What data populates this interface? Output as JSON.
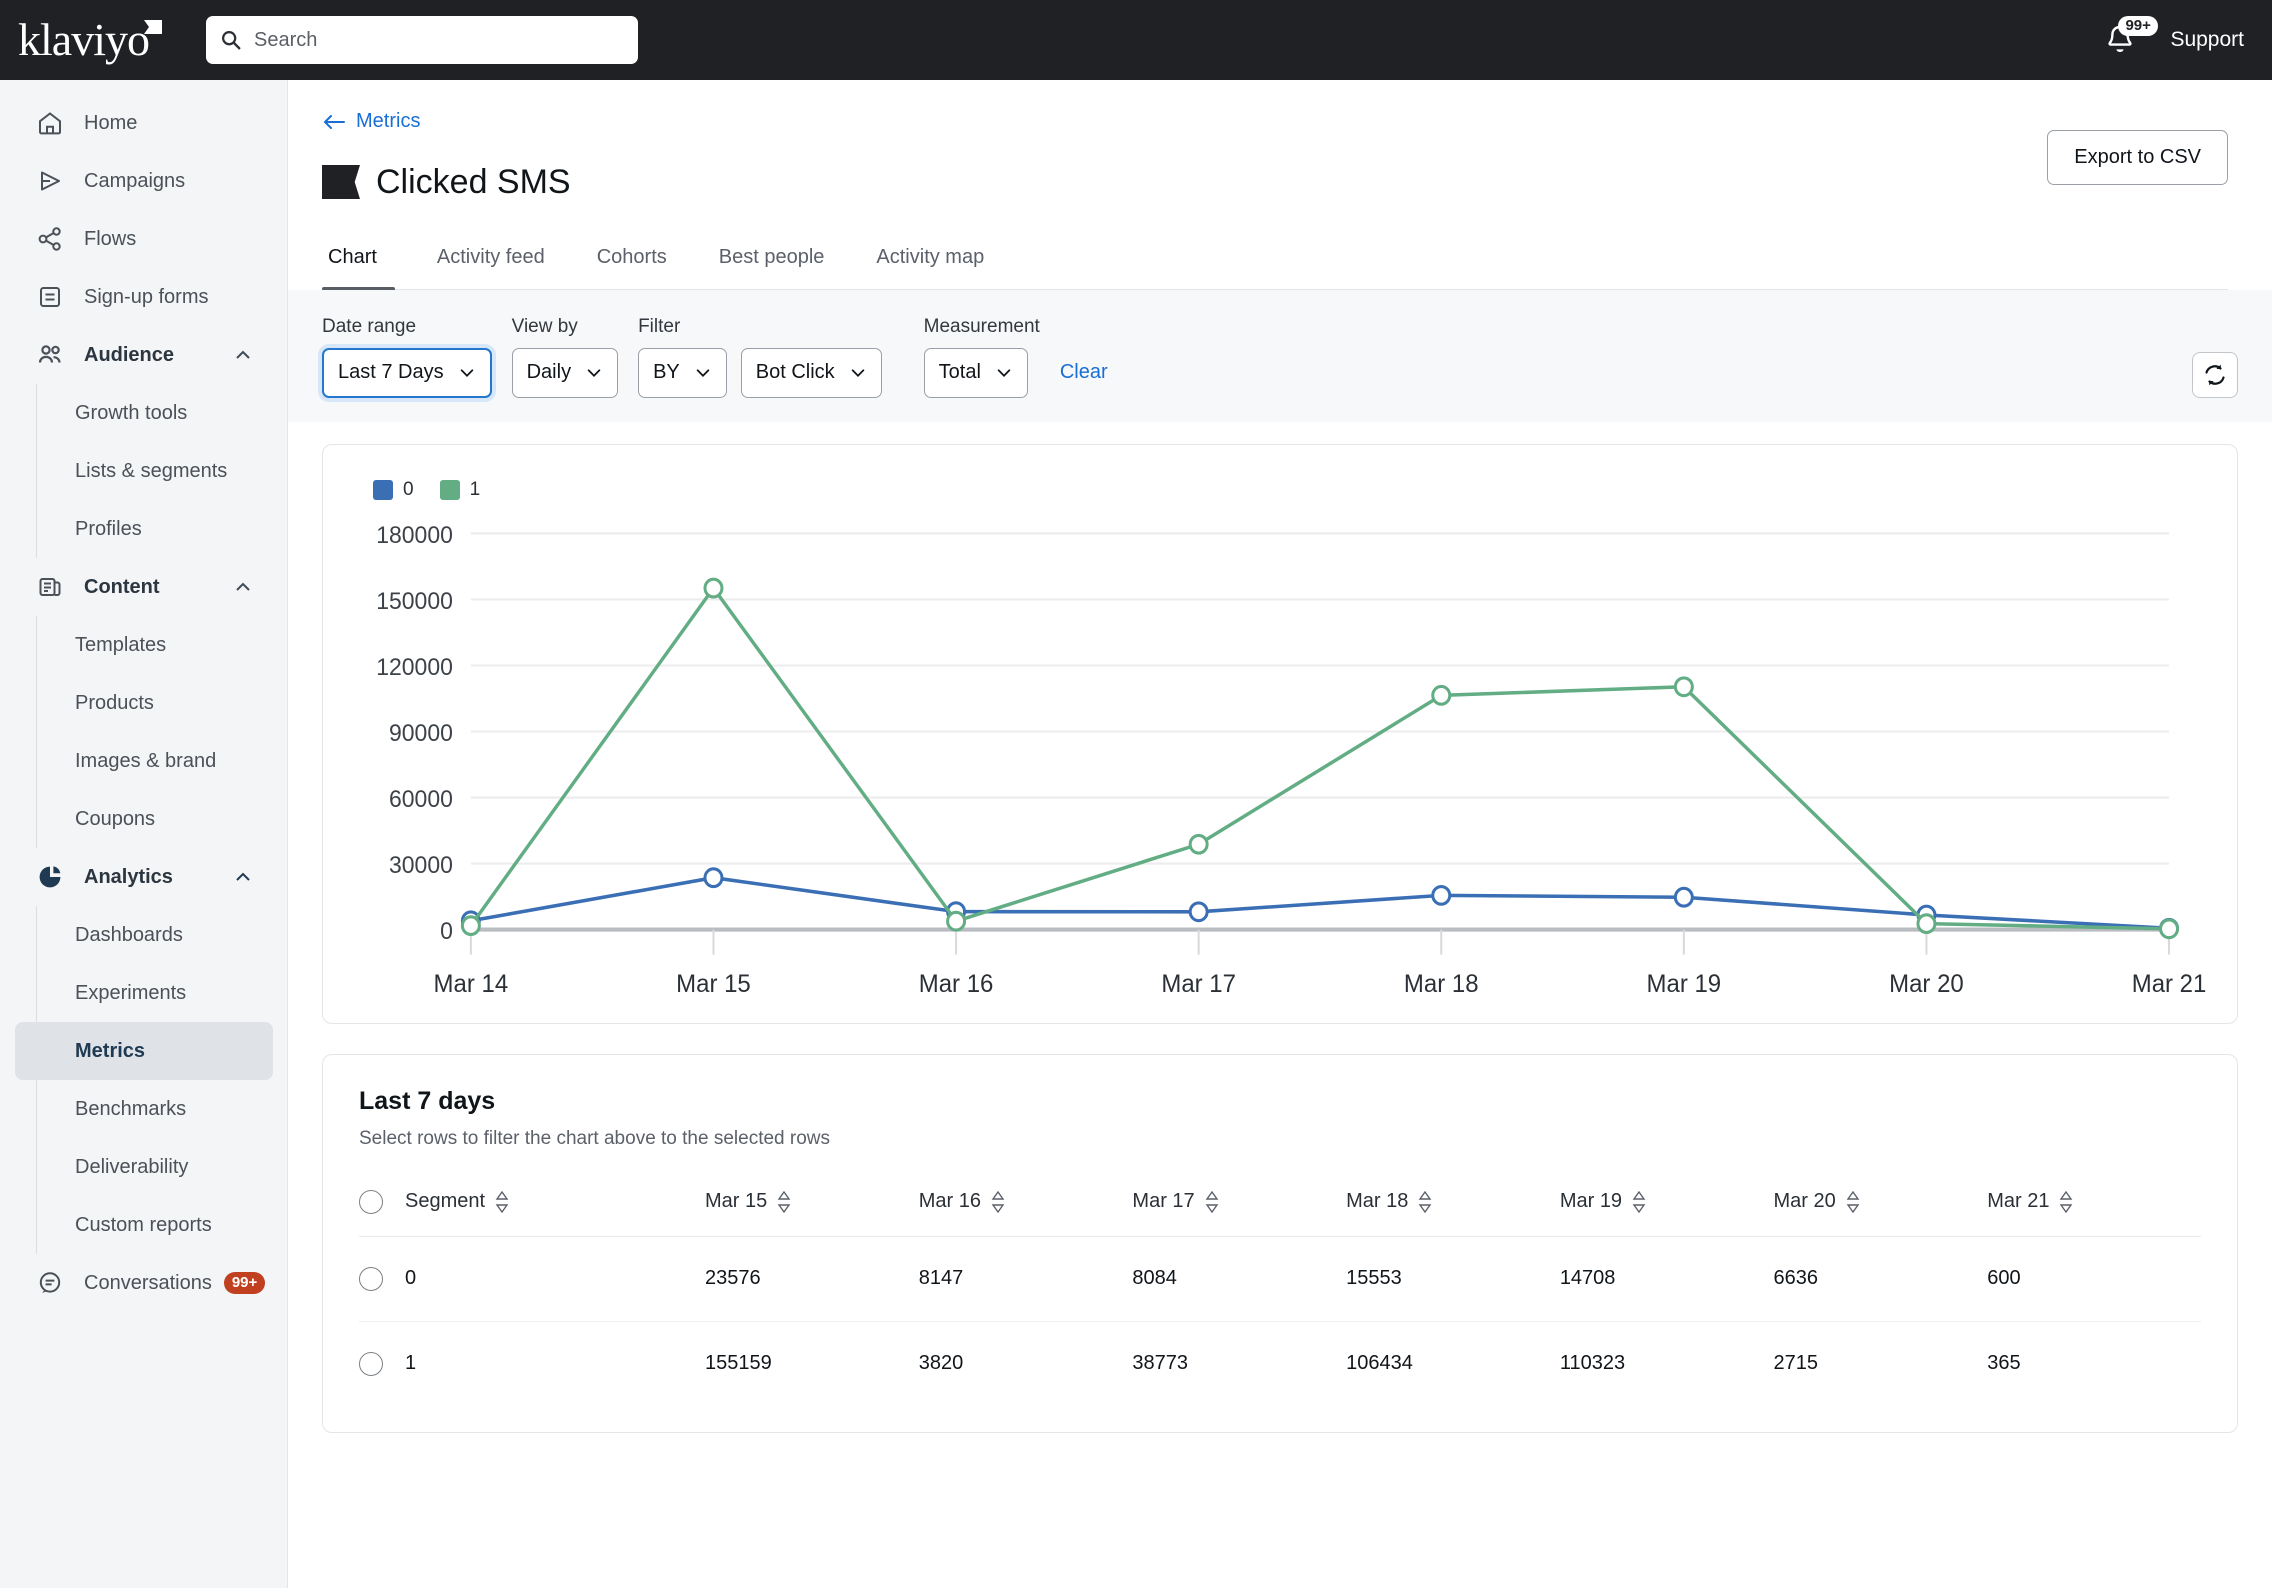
{
  "topbar": {
    "brand": "klaviyo",
    "search_placeholder": "Search",
    "notifications_badge": "99+",
    "support_label": "Support"
  },
  "sidebar": {
    "items": [
      {
        "label": "Home",
        "icon": "home-icon",
        "type": "item"
      },
      {
        "label": "Campaigns",
        "icon": "campaigns-icon",
        "type": "item"
      },
      {
        "label": "Flows",
        "icon": "flows-icon",
        "type": "item"
      },
      {
        "label": "Sign-up forms",
        "icon": "signup-forms-icon",
        "type": "item"
      },
      {
        "label": "Audience",
        "icon": "audience-icon",
        "type": "group",
        "expanded": true
      },
      {
        "label": "Growth tools",
        "type": "sub"
      },
      {
        "label": "Lists & segments",
        "type": "sub"
      },
      {
        "label": "Profiles",
        "type": "sub"
      },
      {
        "label": "Content",
        "icon": "content-icon",
        "type": "group",
        "expanded": true
      },
      {
        "label": "Templates",
        "type": "sub"
      },
      {
        "label": "Products",
        "type": "sub"
      },
      {
        "label": "Images & brand",
        "type": "sub"
      },
      {
        "label": "Coupons",
        "type": "sub"
      },
      {
        "label": "Analytics",
        "icon": "analytics-icon",
        "type": "group",
        "expanded": true
      },
      {
        "label": "Dashboards",
        "type": "sub"
      },
      {
        "label": "Experiments",
        "type": "sub"
      },
      {
        "label": "Metrics",
        "type": "sub",
        "active": true
      },
      {
        "label": "Benchmarks",
        "type": "sub"
      },
      {
        "label": "Deliverability",
        "type": "sub"
      },
      {
        "label": "Custom reports",
        "type": "sub"
      },
      {
        "label": "Conversations",
        "icon": "conversations-icon",
        "type": "item",
        "badge": "99+"
      }
    ]
  },
  "page": {
    "breadcrumb": "Metrics",
    "title": "Clicked SMS",
    "export_label": "Export to CSV",
    "tabs": [
      {
        "label": "Chart",
        "active": true
      },
      {
        "label": "Activity feed",
        "active": false
      },
      {
        "label": "Cohorts",
        "active": false
      },
      {
        "label": "Best people",
        "active": false
      },
      {
        "label": "Activity map",
        "active": false
      }
    ]
  },
  "filters": {
    "date_range": {
      "label": "Date range",
      "value": "Last 7 Days"
    },
    "view_by": {
      "label": "View by",
      "value": "Daily"
    },
    "filter": {
      "label": "Filter",
      "operator": "BY",
      "value": "Bot Click"
    },
    "measurement": {
      "label": "Measurement",
      "value": "Total"
    },
    "clear_label": "Clear"
  },
  "chart_data": {
    "type": "line",
    "title": "",
    "xlabel": "",
    "ylabel": "",
    "grid": true,
    "legend_position": "top-left",
    "x": [
      "Mar 14",
      "Mar 15",
      "Mar 16",
      "Mar 17",
      "Mar 18",
      "Mar 19",
      "Mar 20",
      "Mar 21"
    ],
    "ylim": [
      0,
      180000
    ],
    "yticks": [
      0,
      30000,
      60000,
      90000,
      120000,
      150000,
      180000
    ],
    "ytick_labels": [
      "0",
      "30000",
      "60000",
      "90000",
      "120000",
      "150000",
      "180000"
    ],
    "series": [
      {
        "name": "0",
        "color": "#3b6fb5",
        "values": [
          4000,
          23576,
          8147,
          8084,
          15553,
          14708,
          6636,
          600
        ]
      },
      {
        "name": "1",
        "color": "#62ad83",
        "values": [
          1800,
          155159,
          3820,
          38773,
          106434,
          110323,
          2715,
          365
        ]
      }
    ]
  },
  "table": {
    "title": "Last 7 days",
    "subtitle": "Select rows to filter the chart above to the selected rows",
    "columns": [
      "Segment",
      "Mar 15",
      "Mar 16",
      "Mar 17",
      "Mar 18",
      "Mar 19",
      "Mar 20",
      "Mar 21"
    ],
    "rows": [
      {
        "segment": "0",
        "values": [
          "23576",
          "8147",
          "8084",
          "15553",
          "14708",
          "6636",
          "600"
        ]
      },
      {
        "segment": "1",
        "values": [
          "155159",
          "3820",
          "38773",
          "106434",
          "110323",
          "2715",
          "365"
        ]
      }
    ]
  }
}
